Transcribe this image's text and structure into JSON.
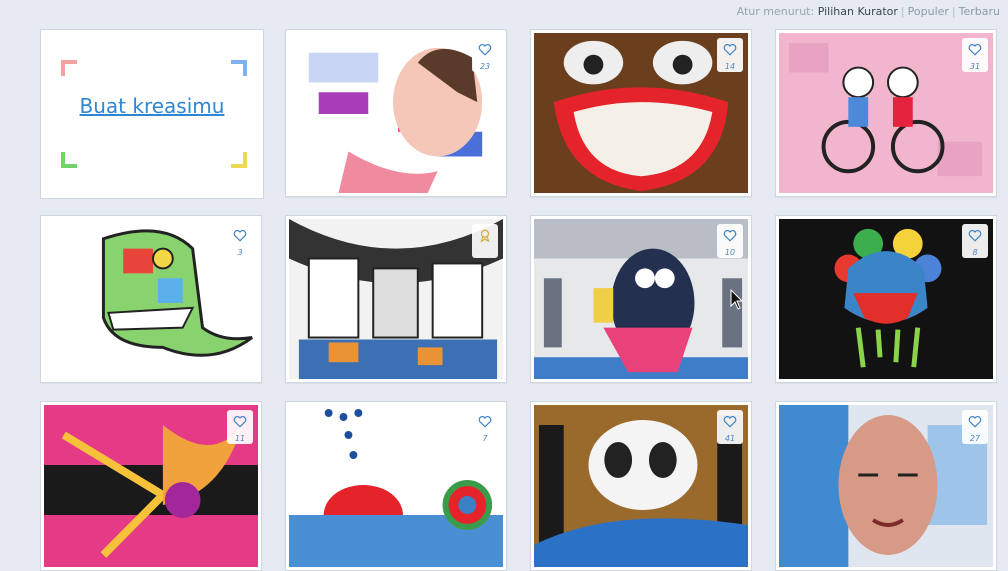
{
  "sort": {
    "label": "Atur menurut:",
    "options": [
      "Pilihan Kurator",
      "Populer",
      "Terbaru"
    ],
    "active": "Pilihan Kurator"
  },
  "create": {
    "label": "Buat kreasimu"
  },
  "tiles": [
    {
      "likes": "23",
      "title": "girl-holding-camera-art"
    },
    {
      "likes": "14",
      "title": "goody-smile-art"
    },
    {
      "likes": "31",
      "title": "couple-on-tandem-bicycle-art"
    },
    {
      "likes": "3",
      "title": "colorful-ghost-monster-art"
    },
    {
      "likes": "",
      "title": "black-white-robot-city-art",
      "badge": "award-ribbon-icon"
    },
    {
      "likes": "10",
      "title": "mural-on-building-art"
    },
    {
      "likes": "8",
      "title": "gas-mask-helmet-art"
    },
    {
      "likes": "11",
      "title": "cupid-bow-art"
    },
    {
      "likes": "7",
      "title": "red-octopus-ocean-art"
    },
    {
      "likes": "41",
      "title": "panda-rainbow-art"
    },
    {
      "likes": "27",
      "title": "portrait-man-art"
    }
  ],
  "colors": {
    "accent": "#2f86d3",
    "background": "#e6ebf3"
  }
}
